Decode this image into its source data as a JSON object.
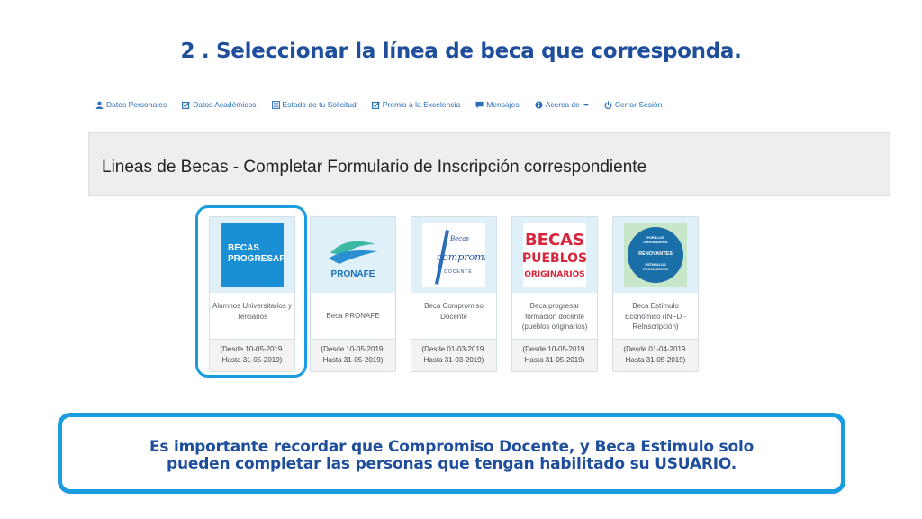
{
  "slide": {
    "title": "2 . Seleccionar la línea de beca que corresponda.",
    "note_line1": "Es importante recordar que Compromiso Docente, y Beca Estimulo solo",
    "note_line2": "pueden completar las personas que tengan habilitado su USUARIO."
  },
  "nav": {
    "items": [
      {
        "label": "Datos Personales",
        "icon": "user-icon"
      },
      {
        "label": "Datos Académicos",
        "icon": "edit-check-icon"
      },
      {
        "label": "Estado de tu Solicitud",
        "icon": "list-icon"
      },
      {
        "label": "Premio a la Excelencia",
        "icon": "edit-check-icon"
      },
      {
        "label": "Mensajes",
        "icon": "chat-icon"
      },
      {
        "label": "Acerca de",
        "icon": "info-icon"
      },
      {
        "label": "Cerrar Sesión",
        "icon": "power-icon"
      }
    ]
  },
  "panel": {
    "heading": "Lineas de Becas - Completar Formulario de Inscripción correspondiente"
  },
  "cards": [
    {
      "logo_line1": "BECAS",
      "logo_line2": "PROGRESAR",
      "name": "Alumnos Universitarios y Terciarios",
      "date_from": "(Desde 10-05-2019.",
      "date_to": "Hasta 31-05-2019)"
    },
    {
      "logo_text": "PRONAFE",
      "name": "Beca PRONAFE",
      "date_from": "(Desde 10-05-2019.",
      "date_to": "Hasta 31-05-2019)"
    },
    {
      "logo_line1": "Becas",
      "logo_line2": "compromiso",
      "logo_line3": "DOCENTE",
      "name": "Beca Compromiso Docente",
      "date_from": "(Desde 01-03-2019.",
      "date_to": "Hasta 31-03-2019)"
    },
    {
      "logo_line1": "BECAS",
      "logo_line2": "PUEBLOS",
      "logo_line3": "ORIGINARIOS",
      "name": "Beca progresar formación docente (pueblos originarios)",
      "date_from": "(Desde 10-05-2019.",
      "date_to": "Hasta 31-05-2019)"
    },
    {
      "logo_line1": "PUEBLOS",
      "logo_line2": "ORIGINARIOS",
      "logo_line3": "RENOVANTES",
      "logo_line4": "ESTIMULOS",
      "logo_line5": "ECONOMICOS",
      "name": "Beca Estímulo Económico (INFD - ReInscripción)",
      "date_from": "(Desde 01-04-2019.",
      "date_to": "Hasta 31-05-2019)"
    }
  ],
  "colors": {
    "title_blue": "#1f4e9c",
    "accent_cyan": "#1a9ce0",
    "nav_link": "#2a6fb8",
    "progresar_blue": "#1a8fd3",
    "pueblos_red": "#d9253a"
  }
}
